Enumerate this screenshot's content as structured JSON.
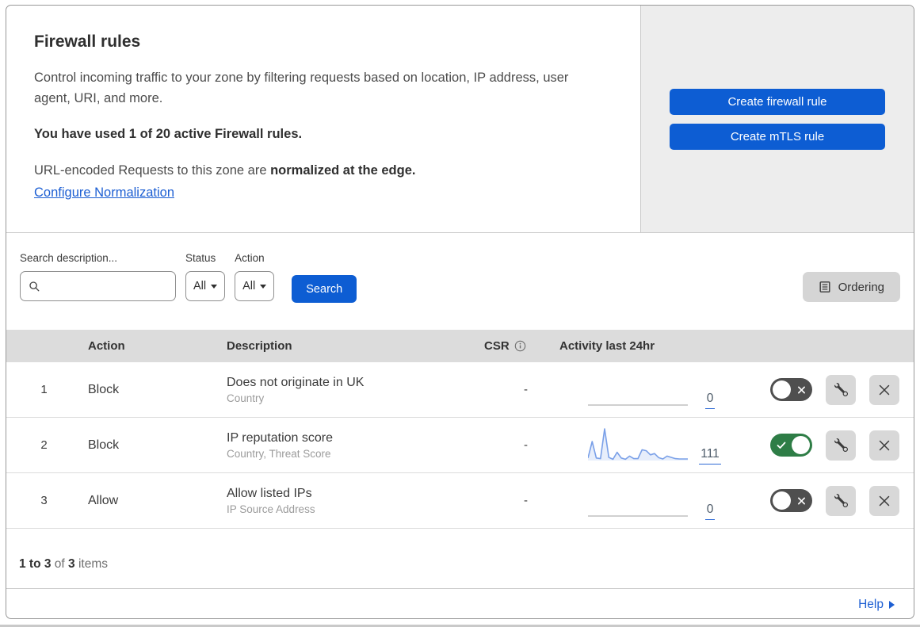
{
  "header": {
    "title": "Firewall rules",
    "description": "Control incoming traffic to your zone by filtering requests based on location, IP address, user agent, URI, and more.",
    "usage": "You have used 1 of 20 active Firewall rules.",
    "normalization_text": "URL-encoded Requests to this zone are ",
    "normalization_bold": "normalized at the edge.",
    "normalization_link": "Configure Normalization",
    "buttons": [
      {
        "label": "Create firewall rule"
      },
      {
        "label": "Create mTLS rule"
      }
    ]
  },
  "filters": {
    "search_label": "Search description...",
    "search_placeholder": "",
    "status_label": "Status",
    "status_value": "All",
    "action_label": "Action",
    "action_value": "All",
    "search_button": "Search",
    "ordering_button": "Ordering"
  },
  "table": {
    "columns": {
      "action": "Action",
      "description": "Description",
      "csr": "CSR",
      "activity": "Activity last 24hr"
    },
    "rows": [
      {
        "priority": "1",
        "action": "Block",
        "description": "Does not originate in UK",
        "criteria": "Country",
        "csr": "-",
        "count": "0",
        "enabled": false,
        "sparkline": []
      },
      {
        "priority": "2",
        "action": "Block",
        "description": "IP reputation score",
        "criteria": "Country, Threat Score",
        "csr": "-",
        "count": "111",
        "enabled": true,
        "sparkline": [
          8,
          60,
          8,
          6,
          100,
          10,
          4,
          26,
          8,
          4,
          14,
          6,
          6,
          34,
          31,
          18,
          22,
          9,
          5,
          14,
          10,
          6,
          5,
          5,
          5
        ]
      },
      {
        "priority": "3",
        "action": "Allow",
        "description": "Allow listed IPs",
        "criteria": "IP Source Address",
        "csr": "-",
        "count": "0",
        "enabled": false,
        "sparkline": []
      }
    ]
  },
  "footer": {
    "range": "1 to 3",
    "of": "of",
    "total": "3",
    "items": "items"
  },
  "help_label": "Help",
  "colors": {
    "primary_blue": "#0d5dd3",
    "link_blue": "#1d5fd3",
    "toggle_on_green": "#2e7d46",
    "toggle_off_gray": "#4f4f4f",
    "sparkline_blue": "#7aa0e8",
    "table_header_gray": "#dcdcdc"
  }
}
